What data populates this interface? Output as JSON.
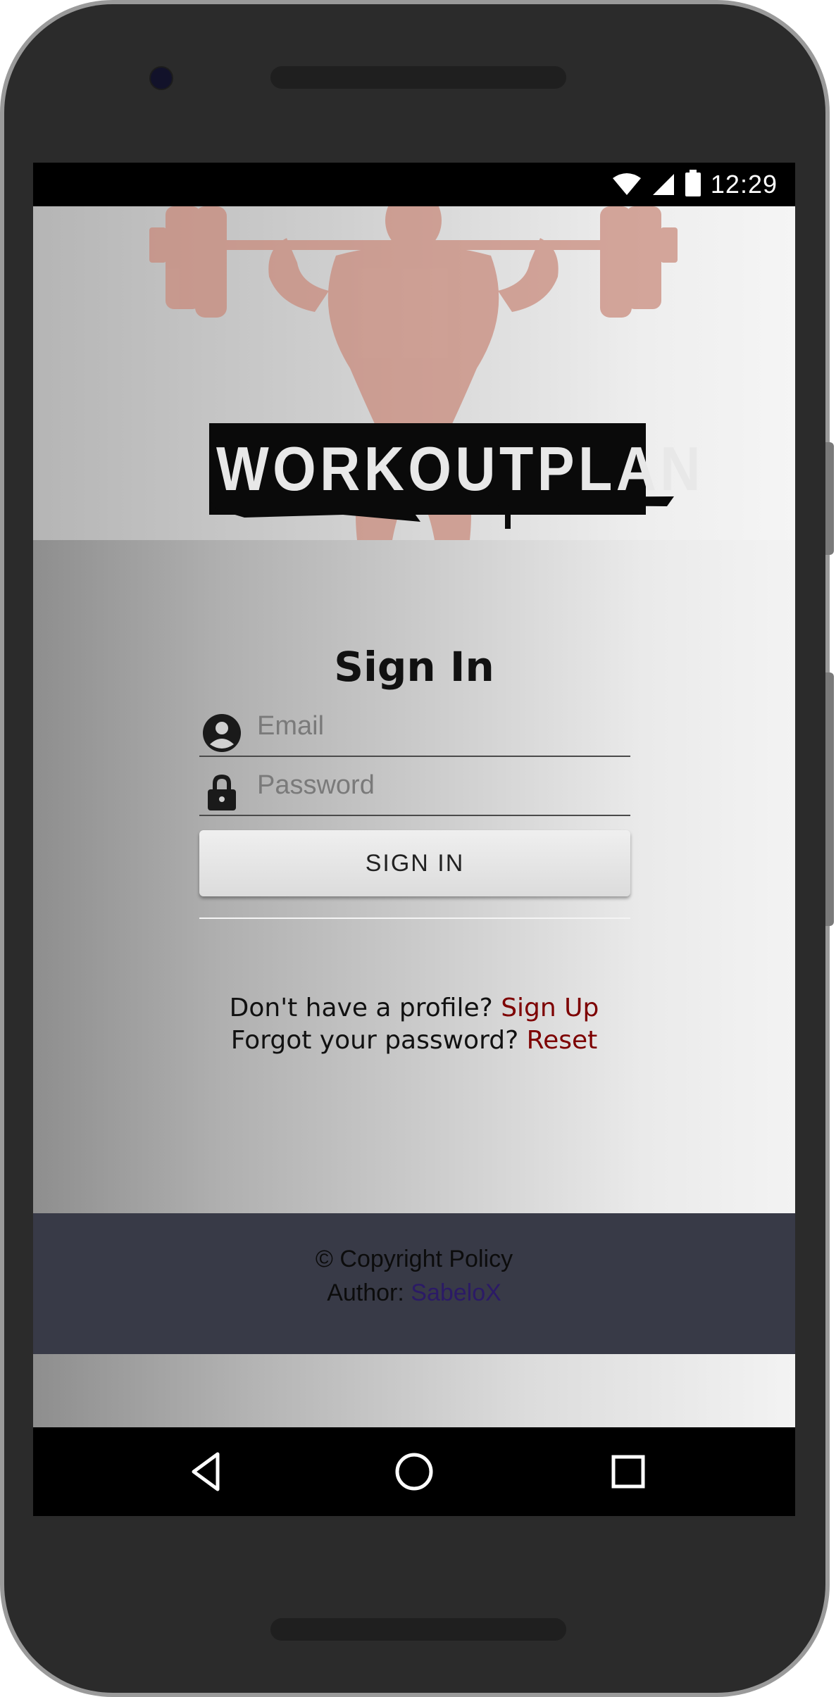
{
  "status_bar": {
    "time": "12:29",
    "icons": [
      "wifi-icon",
      "cell-signal-icon",
      "battery-icon"
    ]
  },
  "hero": {
    "logo_text": "WORKOUTPLAN"
  },
  "signin": {
    "title": "Sign In",
    "email_placeholder": "Email",
    "password_placeholder": "Password",
    "button_label": "SIGN IN"
  },
  "links": {
    "signup_prompt": "Don't have a profile?",
    "signup_label": "Sign Up",
    "reset_prompt": "Forgot your password?",
    "reset_label": "Reset"
  },
  "footer": {
    "copyright": "© Copyright Policy",
    "author_prefix": "Author:",
    "author_name": "SabeloX"
  },
  "nav_bar": {
    "buttons": [
      "back-icon",
      "home-icon",
      "recents-icon"
    ]
  },
  "colors": {
    "link": "#7d0000",
    "footer_bg": "#383a47",
    "author_link": "#2b1a66"
  }
}
